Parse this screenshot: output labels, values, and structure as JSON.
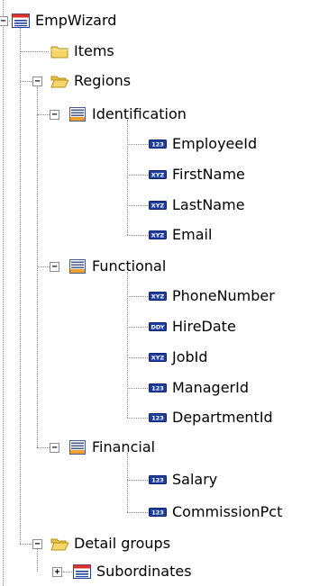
{
  "tree": {
    "root": {
      "label": "EmpWizard",
      "icon": "form-table-icon"
    },
    "nodes": [
      {
        "label": "Items",
        "icon": "folder-closed-icon"
      },
      {
        "label": "Regions",
        "icon": "folder-open-icon"
      },
      {
        "label": "Identification",
        "icon": "region-icon"
      },
      {
        "label": "EmployeeId",
        "icon": "number-item-icon",
        "badge": "123"
      },
      {
        "label": "FirstName",
        "icon": "text-item-icon",
        "badge": "XYZ"
      },
      {
        "label": "LastName",
        "icon": "text-item-icon",
        "badge": "XYZ"
      },
      {
        "label": "Email",
        "icon": "text-item-icon",
        "badge": "XYZ"
      },
      {
        "label": "Functional",
        "icon": "region-icon"
      },
      {
        "label": "PhoneNumber",
        "icon": "text-item-icon",
        "badge": "XYZ"
      },
      {
        "label": "HireDate",
        "icon": "date-item-icon",
        "badge": "DDY"
      },
      {
        "label": "JobId",
        "icon": "text-item-icon",
        "badge": "XYZ"
      },
      {
        "label": "ManagerId",
        "icon": "number-item-icon",
        "badge": "123"
      },
      {
        "label": "DepartmentId",
        "icon": "number-item-icon",
        "badge": "123"
      },
      {
        "label": "Financial",
        "icon": "region-icon"
      },
      {
        "label": "Salary",
        "icon": "number-item-icon",
        "badge": "123"
      },
      {
        "label": "CommissionPct",
        "icon": "number-item-icon",
        "badge": "123"
      },
      {
        "label": "Detail groups",
        "icon": "folder-open-icon"
      },
      {
        "label": "Subordinates",
        "icon": "form-table-icon"
      }
    ],
    "expanders": {
      "collapse": "−",
      "expand": "+"
    },
    "colors": {
      "tree_line": "#8a8a8a",
      "folder": "#f5d66a",
      "region": "#f0a030",
      "badge_bg": "#1f3fa0"
    }
  }
}
